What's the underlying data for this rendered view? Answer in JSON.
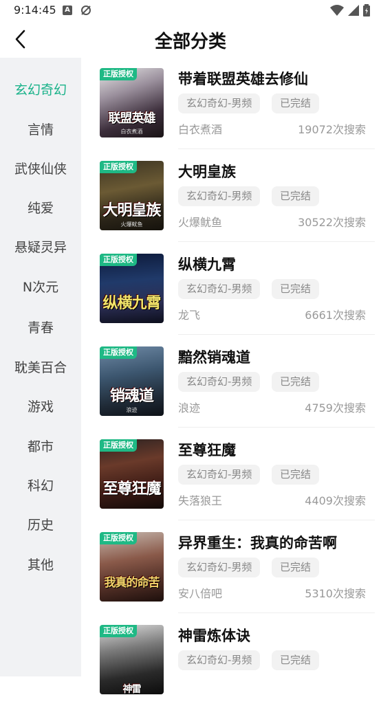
{
  "status": {
    "time": "9:14:45",
    "a_icon": "A"
  },
  "header": {
    "title": "全部分类"
  },
  "sidebar": {
    "items": [
      {
        "label": "玄幻奇幻",
        "active": true
      },
      {
        "label": "言情"
      },
      {
        "label": "武侠仙侠"
      },
      {
        "label": "纯爱"
      },
      {
        "label": "悬疑灵异"
      },
      {
        "label": "N次元"
      },
      {
        "label": "青春"
      },
      {
        "label": "耽美百合"
      },
      {
        "label": "游戏"
      },
      {
        "label": "都市"
      },
      {
        "label": "科幻"
      },
      {
        "label": "历史"
      },
      {
        "label": "其他"
      }
    ]
  },
  "books": [
    {
      "title": "带着联盟英雄去修仙",
      "category": "玄幻奇幻-男频",
      "status": "已完结",
      "author": "白衣煮酒",
      "searches": "19072次搜索",
      "badge": "正版授权",
      "cover_text": "联盟英雄",
      "cover_author": "白衣煮酒"
    },
    {
      "title": "大明皇族",
      "category": "玄幻奇幻-男频",
      "status": "已完结",
      "author": "火爆鱿鱼",
      "searches": "30522次搜索",
      "badge": "正版授权",
      "cover_text": "大明皇族",
      "cover_author": "火爆鱿鱼"
    },
    {
      "title": "纵横九霄",
      "category": "玄幻奇幻-男频",
      "status": "已完结",
      "author": "龙飞",
      "searches": "6661次搜索",
      "badge": "正版授权",
      "cover_text": "纵横九霄",
      "cover_author": ""
    },
    {
      "title": "黯然销魂道",
      "category": "玄幻奇幻-男频",
      "status": "已完结",
      "author": "浪迹",
      "searches": "4759次搜索",
      "badge": "正版授权",
      "cover_text": "销魂道",
      "cover_author": "浪迹"
    },
    {
      "title": "至尊狂魔",
      "category": "玄幻奇幻-男频",
      "status": "已完结",
      "author": "失落狼王",
      "searches": "4409次搜索",
      "badge": "正版授权",
      "cover_text": "至尊狂魔",
      "cover_author": ""
    },
    {
      "title": "异界重生：我真的命苦啊",
      "category": "玄幻奇幻-男频",
      "status": "已完结",
      "author": "安八倍吧",
      "searches": "5310次搜索",
      "badge": "正版授权",
      "cover_text": "我真的命苦",
      "cover_author": ""
    },
    {
      "title": "神雷炼体诀",
      "category": "玄幻奇幻-男频",
      "status": "已完结",
      "author": "",
      "searches": "",
      "badge": "正版授权",
      "cover_text": "神雷",
      "cover_author": ""
    }
  ],
  "colors": {
    "accent": "#19b289",
    "badge": "#1fb985",
    "sidebar_bg": "#f1f2f4"
  }
}
